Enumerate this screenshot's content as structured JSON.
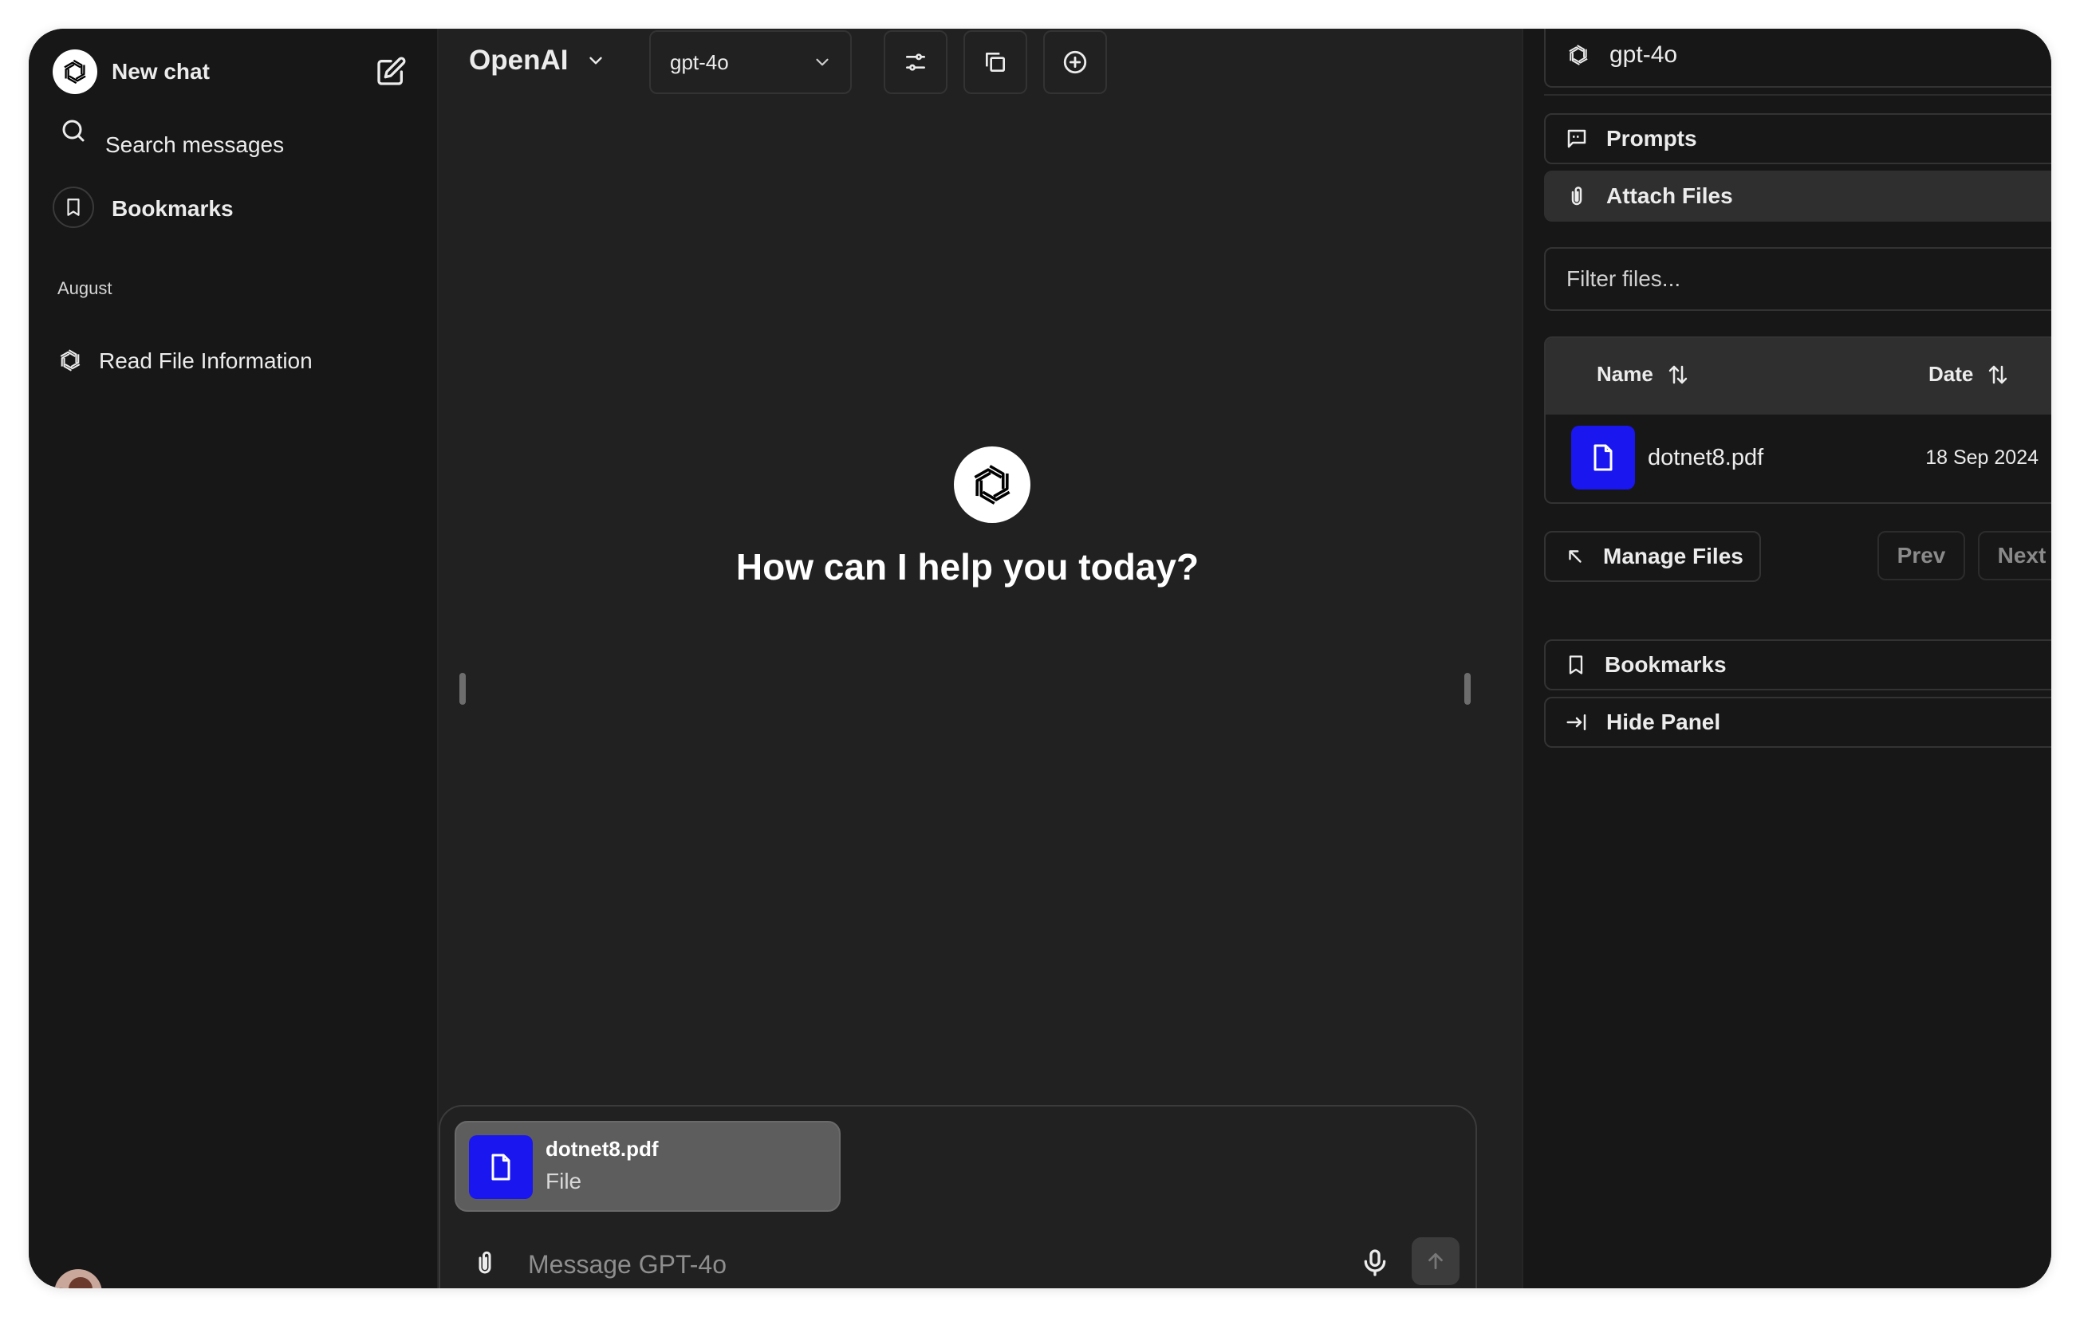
{
  "sidebar": {
    "new_chat": "New chat",
    "search": "Search messages",
    "bookmarks": "Bookmarks",
    "section_label": "August",
    "conversations": [
      {
        "title": "Read File Information"
      }
    ]
  },
  "header": {
    "provider": "OpenAI",
    "model": "gpt-4o"
  },
  "main": {
    "greeting": "How can I help you today?"
  },
  "composer": {
    "attachment_name": "dotnet8.pdf",
    "attachment_type": "File",
    "placeholder": "Message GPT-4o"
  },
  "panel": {
    "model": "gpt-4o",
    "prompts": "Prompts",
    "attach_files": "Attach Files",
    "filter_placeholder": "Filter files...",
    "table": {
      "col_name": "Name",
      "col_date": "Date",
      "rows": [
        {
          "name": "dotnet8.pdf",
          "date": "18 Sep 2024"
        }
      ]
    },
    "manage_files": "Manage Files",
    "prev": "Prev",
    "next": "Next",
    "bookmarks": "Bookmarks",
    "hide_panel": "Hide Panel"
  },
  "colors": {
    "sidebar_bg": "#171717",
    "main_bg": "#212121",
    "file_icon_bg": "#1a16f0",
    "active_item_bg": "#2f2f2f"
  }
}
